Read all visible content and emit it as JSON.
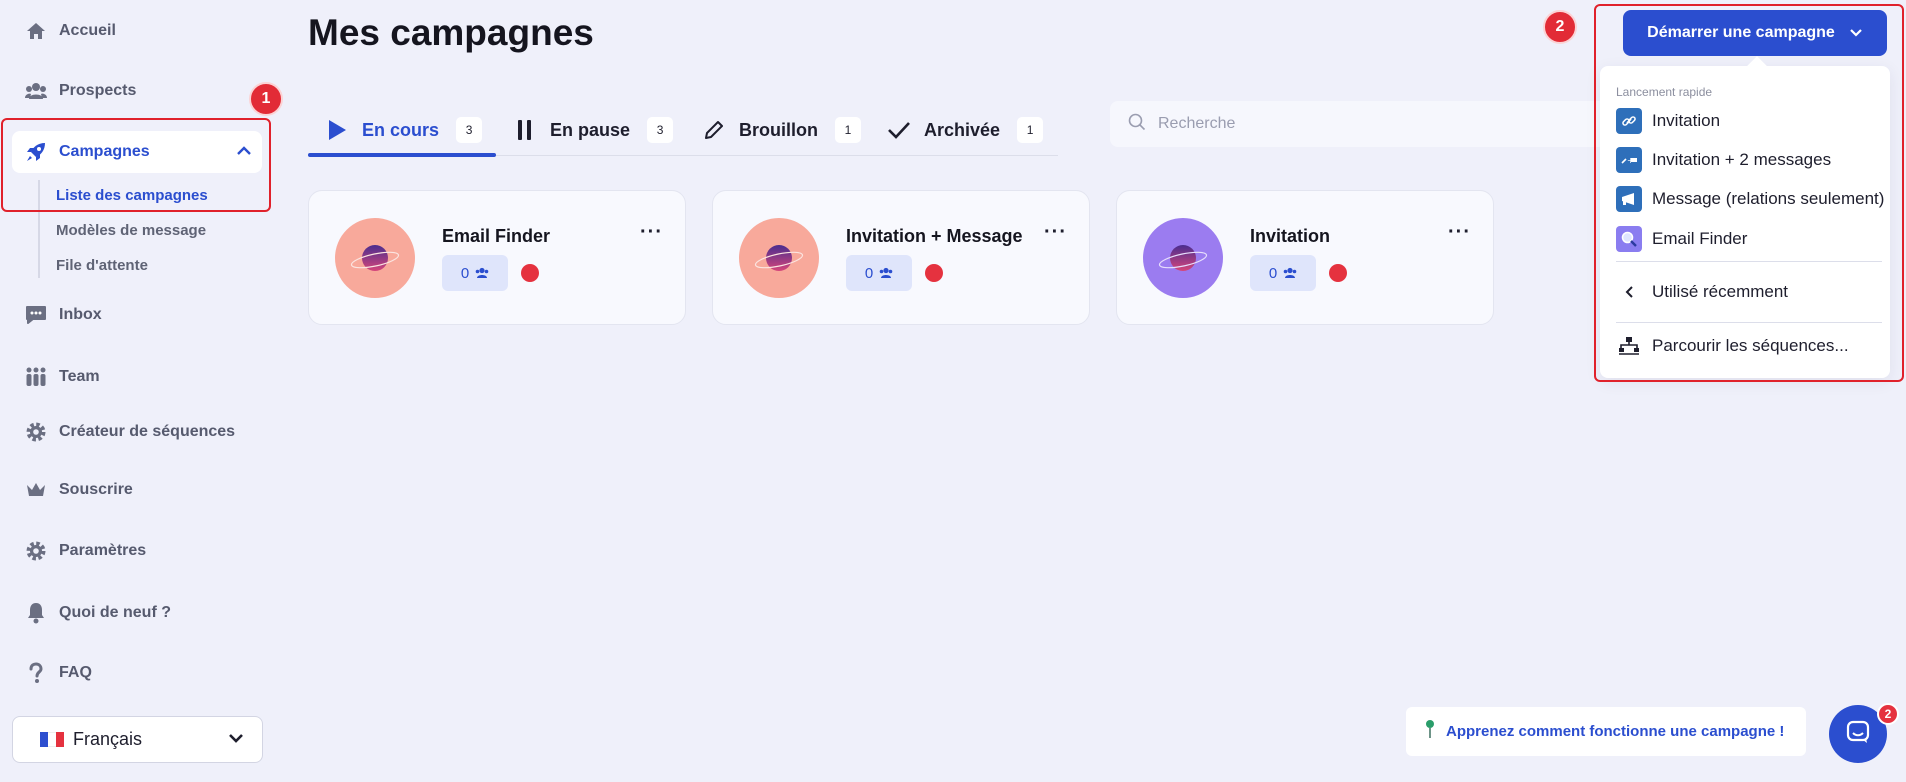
{
  "sidebar": {
    "items": [
      {
        "label": "Accueil",
        "icon": "home-icon"
      },
      {
        "label": "Prospects",
        "icon": "users-icon"
      },
      {
        "label": "Campagnes",
        "icon": "rocket-icon"
      },
      {
        "label": "Inbox",
        "icon": "chat-icon"
      },
      {
        "label": "Team",
        "icon": "team-icon"
      },
      {
        "label": "Créateur de séquences",
        "icon": "gear-icon"
      },
      {
        "label": "Souscrire",
        "icon": "crown-icon"
      },
      {
        "label": "Paramètres",
        "icon": "gear-icon"
      },
      {
        "label": "Quoi de neuf ?",
        "icon": "bell-icon"
      },
      {
        "label": "FAQ",
        "icon": "question-icon"
      }
    ],
    "sub_items": [
      {
        "label": "Liste des campagnes"
      },
      {
        "label": "Modèles de message"
      },
      {
        "label": "File d'attente"
      }
    ],
    "language": "Français"
  },
  "annotations": {
    "badge1": "1",
    "badge2": "2"
  },
  "main": {
    "title": "Mes campagnes",
    "tabs": [
      {
        "label": "En cours",
        "count": "3"
      },
      {
        "label": "En pause",
        "count": "3"
      },
      {
        "label": "Brouillon",
        "count": "1"
      },
      {
        "label": "Archivée",
        "count": "1"
      }
    ],
    "search_placeholder": "Recherche",
    "cards": [
      {
        "name": "Email Finder",
        "count": "0",
        "avatar_color": "#f8a99b"
      },
      {
        "name": "Invitation + Message",
        "count": "0",
        "avatar_color": "#f8a99b"
      },
      {
        "name": "Invitation",
        "count": "0",
        "avatar_color": "#9b7cf0"
      }
    ]
  },
  "start_button": {
    "label": "Démarrer une campagne"
  },
  "dropdown": {
    "header": "Lancement rapide",
    "items": [
      {
        "label": "Invitation"
      },
      {
        "label": "Invitation + 2 messages"
      },
      {
        "label": "Message (relations seulement)"
      },
      {
        "label": "Email Finder"
      }
    ],
    "recent": "Utilisé récemment",
    "browse": "Parcourir les séquences..."
  },
  "help": {
    "label": "Apprenez comment fonctionne une campagne !"
  },
  "chat": {
    "badge": "2"
  },
  "colors": {
    "accent": "#2b4ecf",
    "background": "#eff0fa",
    "annotation": "#e0212b",
    "status_red": "#e5323f"
  }
}
